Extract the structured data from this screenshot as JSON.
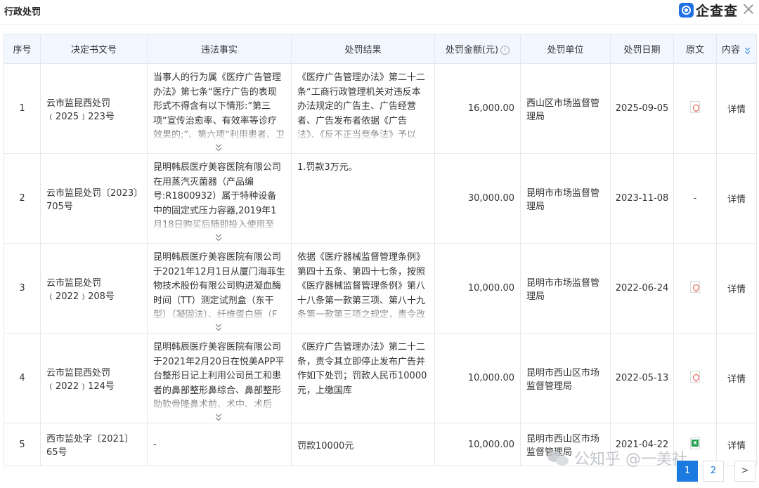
{
  "header": {
    "section_title": "行政处罚",
    "brand_name": "企查查"
  },
  "table": {
    "columns": [
      "序号",
      "决定书文号",
      "违法事实",
      "处罚结果",
      "处罚金额(元)",
      "处罚单位",
      "处罚日期",
      "原文",
      "内容"
    ],
    "rows": [
      {
        "index": "1",
        "doc_no": "云市监昆西处罚﹙2025﹚223号",
        "fact": "当事人的行为属《医疗广告管理办法》第七条“医疗广告的表现形式不得含有以下情形:”第三项“宣传治愈率、有效率等诊疗效果的;”、第六项“利用患者、卫",
        "result": "《医疗广告管理办法》第二十二条“工商行政管理机关对违反本办法规定的广告主、广告经营者、广告发布者依据《广告法》、《反不正当竞争法》予以",
        "amount": "16,000.00",
        "authority": "西山区市场监督管理局",
        "date": "2025-09-05",
        "doc_type": "pdf",
        "detail": "详情"
      },
      {
        "index": "2",
        "doc_no": "云市监昆处罚〔2023〕705号",
        "fact": "昆明韩辰医疗美容医院有限公司在用蒸汽灭菌器（产品编号:R1800932）属于特种设备中的固定式压力容器,2019年1月18日购买后随即投入使用至今,使用年限已超",
        "result": "1.罚款3万元。",
        "amount": "30,000.00",
        "authority": "昆明市市场监督管理局",
        "date": "2023-11-08",
        "doc_type": "none",
        "doc_placeholder": "-",
        "detail": "详情"
      },
      {
        "index": "3",
        "doc_no": "云市监昆处罚﹙2022﹚208号",
        "fact": "昆明韩辰医疗美容医院有限公司于2021年12月1日从厦门海菲生物技术股份有限公司购进凝血酶时间（TT）测定试剂盒（东干型）（凝固法）、纤维蛋白原（F",
        "result": "依据《医疗器械监督管理条例》第四十五条、第四十七条，按照《医疗器械监督管理条例》第八十八条第一款第三项、第八十九条第一款第三项之规定，责令改",
        "amount": "10,000.00",
        "authority": "昆明市市场监督管理局",
        "date": "2022-06-24",
        "doc_type": "pdf",
        "detail": "详情"
      },
      {
        "index": "4",
        "doc_no": "云市监昆西处罚﹙2022﹚124号",
        "fact": "昆明韩辰医疗美容医院有限公司于2021年2月20日在悦美APP平台整形日记上利用公司员工和患者的鼻部整形鼻综合、鼻部整形助软骨隆鼻术前、术中、术后",
        "result": "《医疗广告管理办法》第二十二条，责令其立即停止发布广告并作如下处罚；罚款人民币10000元，上缴国库",
        "amount": "10,000.00",
        "authority": "昆明市西山区市场监督管理局",
        "date": "2022-05-13",
        "doc_type": "pdf",
        "detail": "详情"
      },
      {
        "index": "5",
        "doc_no": "西市监处字〔2021〕65号",
        "fact": "-",
        "result": "罚款10000元",
        "amount": "10,000.00",
        "authority": "昆明市西山区市场监督管理局",
        "date": "2021-04-22",
        "doc_type": "xls",
        "detail": "详情"
      }
    ]
  },
  "pagination": {
    "pages": [
      "1",
      "2"
    ],
    "current": "1",
    "next": ">"
  },
  "watermark": "公知乎 @一美社"
}
